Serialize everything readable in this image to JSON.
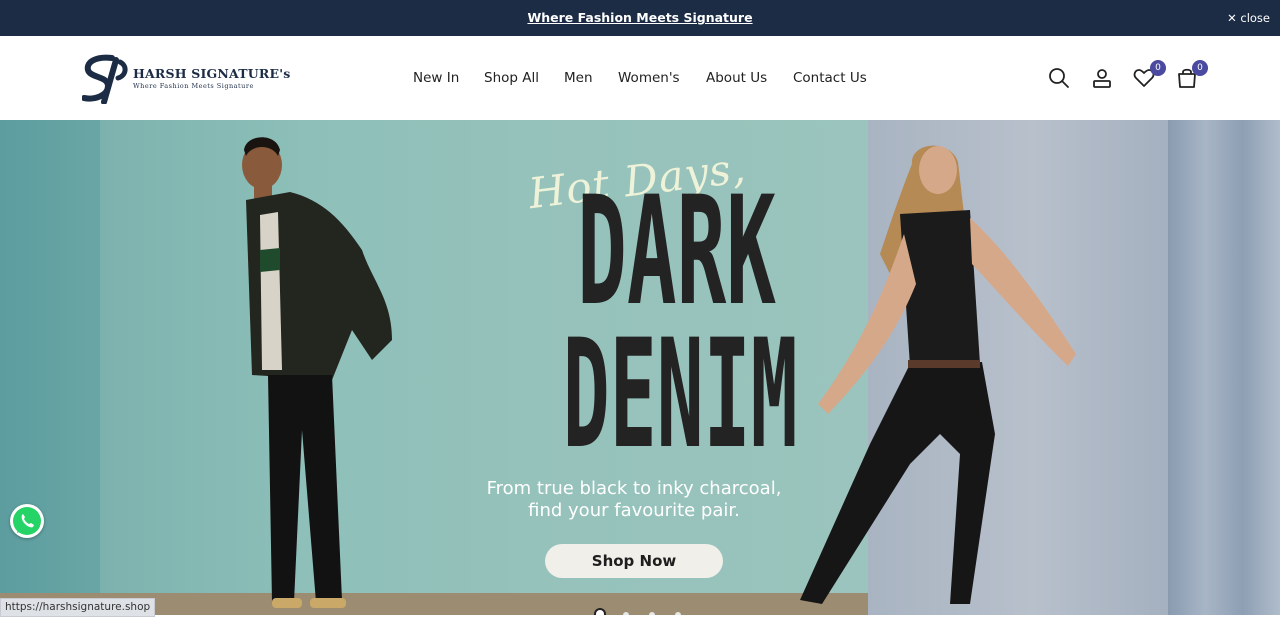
{
  "announcement": {
    "text": "Where Fashion Meets Signature",
    "close_label": "close"
  },
  "brand": {
    "name": "HARSH SIGNATURE's",
    "tagline": "Where Fashion Meets Signature"
  },
  "nav": [
    "New In",
    "Shop All",
    "Men",
    "Women's",
    "About Us",
    "Contact Us"
  ],
  "header_icons": {
    "search": "search-icon",
    "account": "user-icon",
    "wishlist": "heart-icon",
    "cart": "bag-icon"
  },
  "counts": {
    "wishlist": "0",
    "cart": "0"
  },
  "hero": {
    "script": "Hot Days,",
    "line1": "DARK",
    "line2": "DENIM",
    "sub1": "From true black to inky charcoal,",
    "sub2": "find your favourite pair.",
    "cta": "Shop Now",
    "slides": 4,
    "active_slide": 1
  },
  "status_url": "https://harshsignature.shop",
  "colors": {
    "primary": "#1c2c45",
    "badge": "#4a4aa0",
    "whatsapp": "#25d366"
  }
}
